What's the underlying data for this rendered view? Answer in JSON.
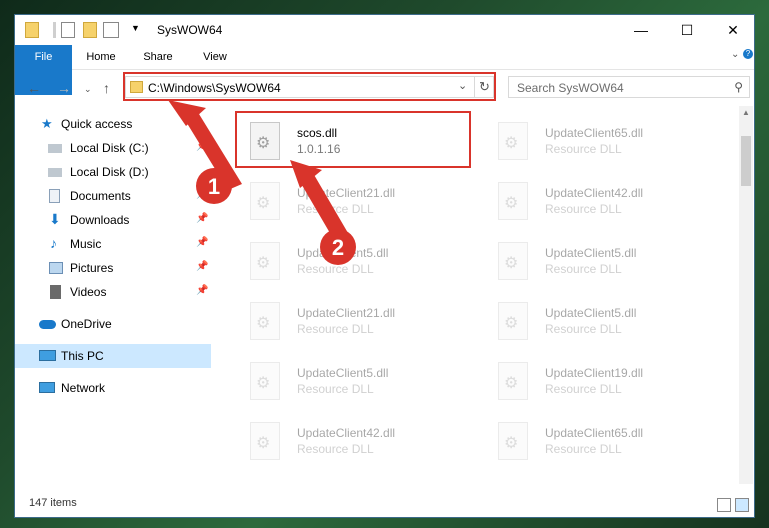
{
  "window": {
    "title": "SysWOW64",
    "controls": [
      "minimize",
      "maximize",
      "close"
    ]
  },
  "ribbon": {
    "tabs": [
      {
        "label": "File",
        "active": true
      },
      {
        "label": "Home"
      },
      {
        "label": "Share"
      },
      {
        "label": "View"
      }
    ]
  },
  "address": {
    "path": "C:\\Windows\\SysWOW64",
    "search_placeholder": "Search SysWOW64"
  },
  "sidebar": {
    "items": [
      {
        "label": "Quick access",
        "icon": "star-icon"
      },
      {
        "label": "Local Disk (C:)",
        "icon": "drive-icon"
      },
      {
        "label": "Local Disk (D:)",
        "icon": "drive-icon"
      },
      {
        "label": "Documents",
        "icon": "document-icon"
      },
      {
        "label": "Downloads",
        "icon": "download-icon"
      },
      {
        "label": "Music",
        "icon": "music-icon"
      },
      {
        "label": "Pictures",
        "icon": "pictures-icon"
      },
      {
        "label": "Videos",
        "icon": "video-icon"
      },
      {
        "label": "OneDrive",
        "icon": "cloud-icon"
      },
      {
        "label": "This PC",
        "icon": "computer-icon",
        "selected": true
      },
      {
        "label": "Network",
        "icon": "network-icon"
      }
    ]
  },
  "files": [
    {
      "name": "scos.dll",
      "desc": "1.0.1.16",
      "highlighted": true
    },
    {
      "name": "UpdateClient65.dll",
      "desc": "Resource DLL"
    },
    {
      "name": "UpdateClient21.dll",
      "desc": "Resource DLL"
    },
    {
      "name": "UpdateClient42.dll",
      "desc": "Resource DLL"
    },
    {
      "name": "UpdateClient5.dll",
      "desc": "Resource DLL"
    },
    {
      "name": "UpdateClient5.dll",
      "desc": "Resource DLL"
    },
    {
      "name": "UpdateClient21.dll",
      "desc": "Resource DLL"
    },
    {
      "name": "UpdateClient5.dll",
      "desc": "Resource DLL"
    },
    {
      "name": "UpdateClient5.dll",
      "desc": "Resource DLL"
    },
    {
      "name": "UpdateClient19.dll",
      "desc": "Resource DLL"
    },
    {
      "name": "UpdateClient42.dll",
      "desc": "Resource DLL"
    },
    {
      "name": "UpdateClient65.dll",
      "desc": "Resource DLL"
    }
  ],
  "status": {
    "item_count": "147 items"
  },
  "annotations": {
    "step1": "1",
    "step2": "2",
    "color": "#d9342b"
  },
  "colors": {
    "accent": "#1979ca",
    "selected_bg": "#cce8ff",
    "highlight": "#d9342b"
  }
}
